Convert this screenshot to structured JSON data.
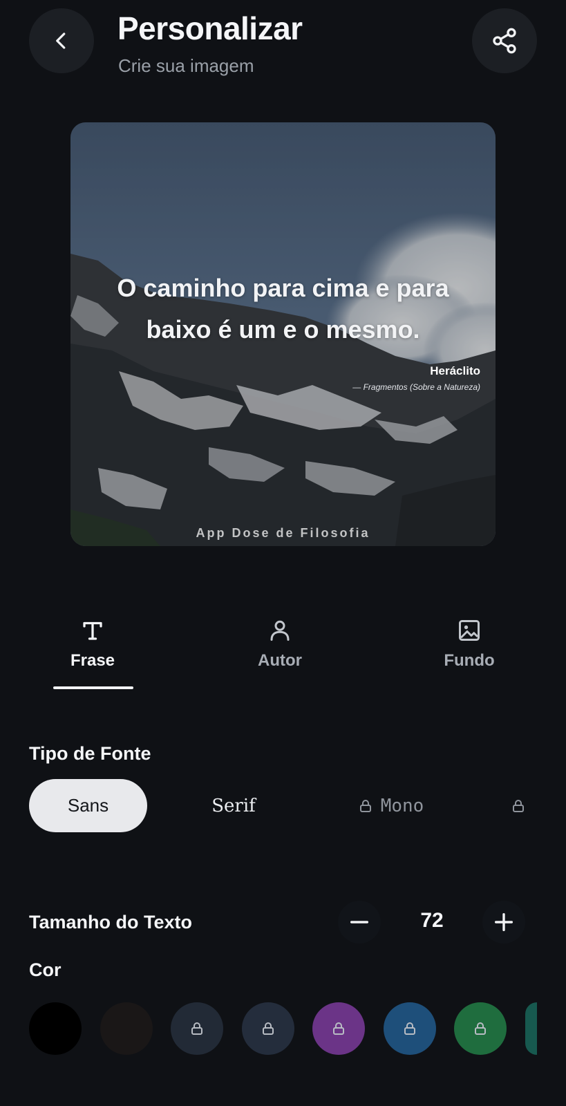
{
  "header": {
    "title": "Personalizar",
    "subtitle": "Crie sua imagem",
    "back_icon": "chevron-left-icon",
    "share_icon": "share-icon"
  },
  "preview": {
    "quote": "O caminho para cima e para baixo é um e o mesmo.",
    "author": "Heráclito",
    "work": "— Fragmentos (Sobre a Natureza)",
    "watermark": "App Dose de Filosofia"
  },
  "tabs": [
    {
      "label": "Frase",
      "icon": "text-icon",
      "active": true
    },
    {
      "label": "Autor",
      "icon": "person-icon",
      "active": false
    },
    {
      "label": "Fundo",
      "icon": "image-icon",
      "active": false
    }
  ],
  "font_section": {
    "label": "Tipo de Fonte",
    "options": [
      {
        "label": "Sans",
        "selected": true,
        "locked": false
      },
      {
        "label": "Serif",
        "selected": false,
        "locked": false
      },
      {
        "label": "Mono",
        "selected": false,
        "locked": true
      },
      {
        "label": "",
        "selected": false,
        "locked": true
      }
    ]
  },
  "size_section": {
    "label": "Tamanho do Texto",
    "value": "72",
    "decrement_icon": "minus-icon",
    "increment_icon": "plus-icon"
  },
  "color_section": {
    "label": "Cor",
    "swatches": [
      {
        "color": "#000000",
        "locked": false
      },
      {
        "color": "#1a1717",
        "locked": false
      },
      {
        "color": "#222a36",
        "locked": true
      },
      {
        "color": "#242d3c",
        "locked": true
      },
      {
        "color": "#6b3487",
        "locked": true
      },
      {
        "color": "#1e4f7a",
        "locked": true
      },
      {
        "color": "#1f6d3e",
        "locked": true
      },
      {
        "color": "#17594f",
        "locked": false
      }
    ]
  },
  "colors": {
    "background": "#0f1115",
    "button_bg": "#1c1f24",
    "text_primary": "#f5f6f8",
    "text_secondary": "#9aa0a8",
    "chip_selected": "#e8e9ec"
  }
}
